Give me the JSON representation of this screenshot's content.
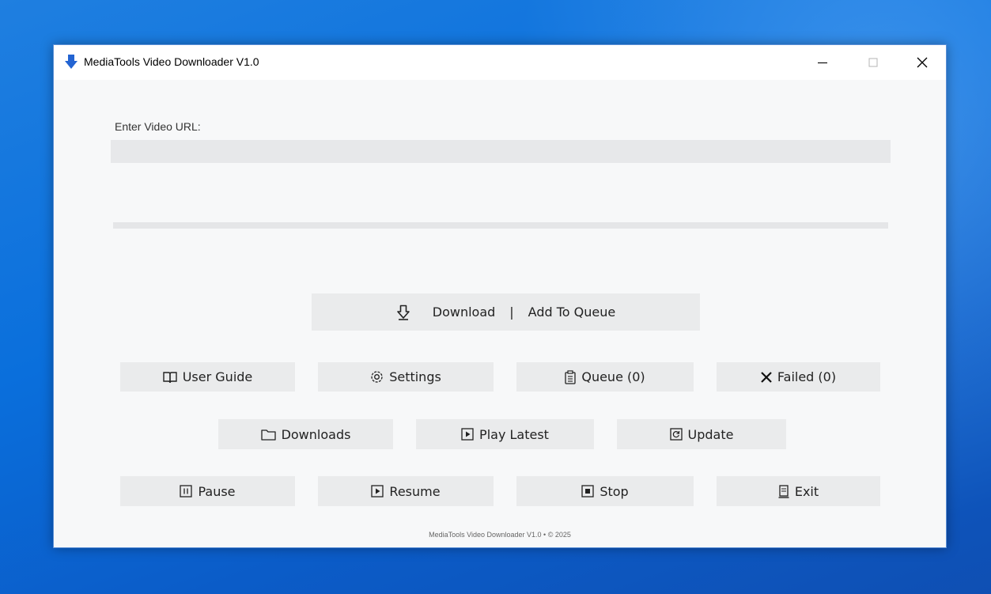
{
  "window": {
    "title": "MediaTools Video Downloader V1.0"
  },
  "form": {
    "url_label": "Enter Video URL:",
    "url_value": "",
    "url_placeholder": ""
  },
  "progress": {
    "value_percent": 0
  },
  "primary_action": {
    "download_label": "Download",
    "separator": "|",
    "queue_label": "Add To Queue"
  },
  "buttons": {
    "user_guide": "User Guide",
    "settings": "Settings",
    "queue": "Queue (0)",
    "failed": "Failed (0)",
    "downloads": "Downloads",
    "play_latest": "Play Latest",
    "update": "Update",
    "pause": "Pause",
    "resume": "Resume",
    "stop": "Stop",
    "exit": "Exit"
  },
  "footer": {
    "text": "MediaTools Video Downloader V1.0 • © 2025"
  },
  "colors": {
    "accent": "#2364d2",
    "window_bg": "#f7f8f9",
    "button_bg": "#eaebec",
    "input_bg": "#e7e8ea"
  }
}
